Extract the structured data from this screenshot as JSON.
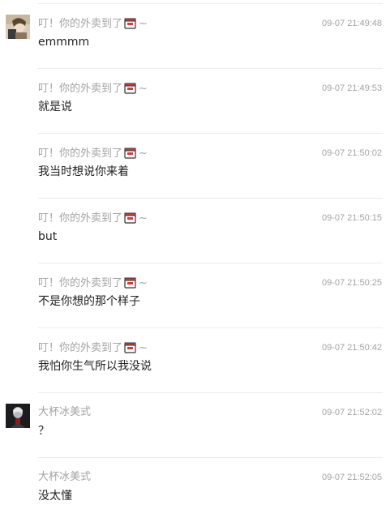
{
  "messages": [
    {
      "sender": "叮！你的外卖到了",
      "sender_emoji": "takeout-box-icon",
      "sender_suffix": "~",
      "time": "09-07 21:49:48",
      "text": "emmmm",
      "avatar": "photo"
    },
    {
      "sender": "叮！你的外卖到了",
      "sender_emoji": "takeout-box-icon",
      "sender_suffix": "~",
      "time": "09-07 21:49:53",
      "text": "就是说"
    },
    {
      "sender": "叮！你的外卖到了",
      "sender_emoji": "takeout-box-icon",
      "sender_suffix": "~",
      "time": "09-07 21:50:02",
      "text": "我当时想说你来着"
    },
    {
      "sender": "叮！你的外卖到了",
      "sender_emoji": "takeout-box-icon",
      "sender_suffix": "~",
      "time": "09-07 21:50:15",
      "text": "but"
    },
    {
      "sender": "叮！你的外卖到了",
      "sender_emoji": "takeout-box-icon",
      "sender_suffix": "~",
      "time": "09-07 21:50:25",
      "text": "不是你想的那个样子"
    },
    {
      "sender": "叮！你的外卖到了",
      "sender_emoji": "takeout-box-icon",
      "sender_suffix": "~",
      "time": "09-07 21:50:42",
      "text": "我怕你生气所以我没说"
    },
    {
      "sender": "大杯冰美式",
      "time": "09-07 21:52:02",
      "text": "？",
      "avatar": "photo"
    },
    {
      "sender": "大杯冰美式",
      "time": "09-07 21:52:05",
      "text": "没太懂"
    }
  ],
  "colors": {
    "meta_text": "#a3a3a3",
    "body_text": "#222222",
    "divider": "#ececec"
  }
}
